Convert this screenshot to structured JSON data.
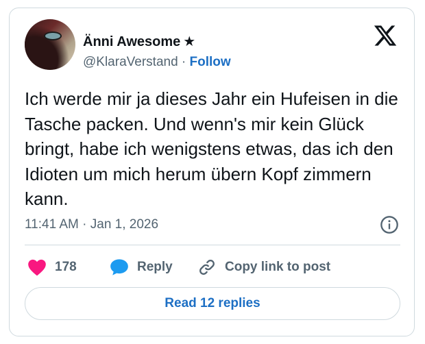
{
  "author": {
    "display_name": "Änni Awesome",
    "badge": "★",
    "handle": "@KlaraVerstand",
    "separator": "·",
    "follow_label": "Follow"
  },
  "tweet": {
    "text": "Ich werde mir ja dieses Jahr ein Hufeisen in die Tasche packen. Und wenn's mir kein Glück bringt, habe ich wenigstens etwas, das ich den Idioten um mich herum übern Kopf zimmern kann.",
    "timestamp": "11:41 AM · Jan 1, 2026"
  },
  "actions": {
    "like_count": "178",
    "reply_label": "Reply",
    "copy_label": "Copy link to post"
  },
  "footer": {
    "read_replies_label": "Read 12 replies"
  },
  "colors": {
    "accent": "#1d6fc4",
    "like": "#f91880",
    "reply": "#1d9bf0",
    "muted": "#536471",
    "border": "#cfd9de"
  },
  "icons": {
    "logo": "x-logo-icon",
    "info": "info-icon",
    "like": "heart-icon",
    "reply": "speech-bubble-icon",
    "copy": "link-icon"
  }
}
